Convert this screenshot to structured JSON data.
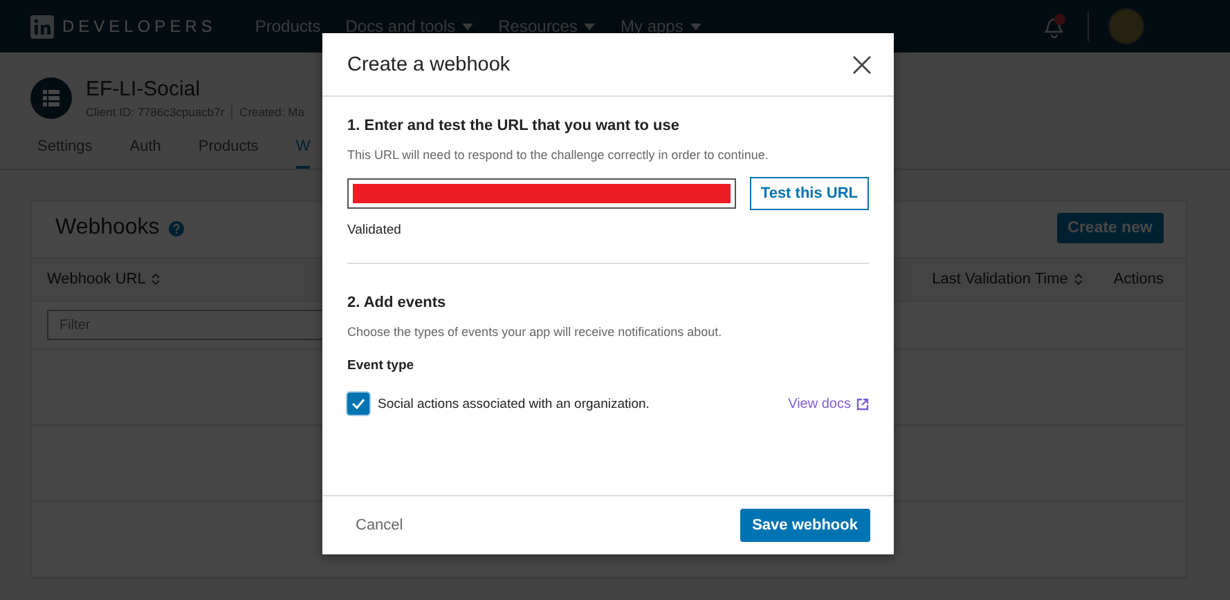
{
  "top_nav": {
    "brand": "DEVELOPERS",
    "items": [
      {
        "label": "Products",
        "dropdown": false
      },
      {
        "label": "Docs and tools",
        "dropdown": true
      },
      {
        "label": "Resources",
        "dropdown": true
      },
      {
        "label": "My apps",
        "dropdown": true
      }
    ],
    "notification_badge": true
  },
  "app": {
    "name": "EF-LI-Social",
    "client_id": "Client ID: 7786c3cpuacb7r",
    "created": "Created: Ma"
  },
  "tabs": [
    {
      "label": "Settings",
      "selected": false
    },
    {
      "label": "Auth",
      "selected": false
    },
    {
      "label": "Products",
      "selected": false
    },
    {
      "label": "W",
      "selected": true
    }
  ],
  "webhooks_card": {
    "title": "Webhooks",
    "create_button": "Create new",
    "columns": [
      {
        "label": "Webhook URL",
        "sortable": true
      },
      {
        "label": "Last Validation Time",
        "sortable": true
      },
      {
        "label": "Actions",
        "sortable": false
      }
    ],
    "filter_placeholder": "Filter"
  },
  "modal": {
    "title": "Create a webhook",
    "step_1": {
      "heading": "1. Enter and test the URL that you want to use",
      "description": "This URL will need to respond to the challenge correctly in order to continue.",
      "url_redacted": true,
      "test_button": "Test this URL",
      "status": "Validated"
    },
    "step_2": {
      "heading": "2. Add events",
      "description": "Choose the types of events your app will receive notifications about.",
      "event_type_label": "Event type",
      "events": [
        {
          "label": "Social actions associated with an organization.",
          "checked": true,
          "link": "View docs"
        }
      ]
    },
    "cancel_button": "Cancel",
    "save_button": "Save webhook"
  }
}
